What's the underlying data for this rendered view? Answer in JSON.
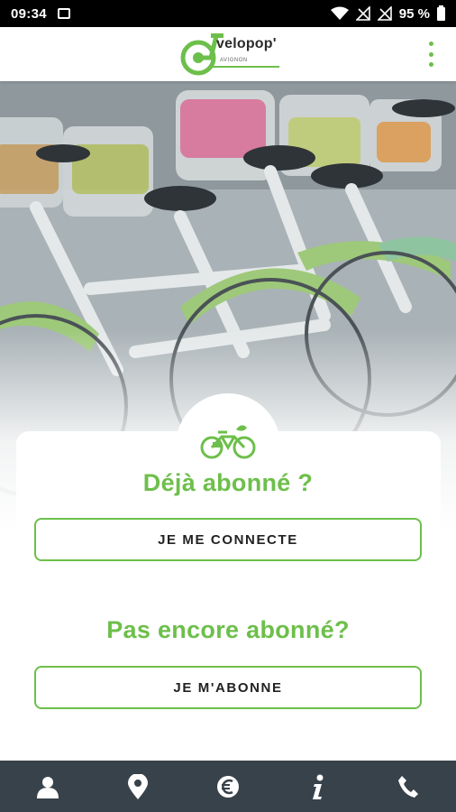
{
  "status_bar": {
    "time": "09:34",
    "battery_label": "95 %",
    "icons": [
      "image-icon",
      "wifi-icon",
      "no-signal-icon",
      "no-signal-icon",
      "battery-icon"
    ]
  },
  "header": {
    "logo_text": "velopop'",
    "logo_subtext": "AVIGNON",
    "menu_icon": "more-vert-icon"
  },
  "colors": {
    "accent": "#6dbf4b",
    "nav_background": "#38424a"
  },
  "subscribed": {
    "title": "Déjà abonné ?",
    "button_label": "JE ME CONNECTE"
  },
  "not_subscribed": {
    "title": "Pas encore abonné?",
    "button_label": "JE M'ABONNE"
  },
  "bottom_nav": {
    "items": [
      {
        "icon": "user-icon"
      },
      {
        "icon": "map-pin-icon"
      },
      {
        "icon": "euro-icon"
      },
      {
        "icon": "info-icon"
      },
      {
        "icon": "phone-icon"
      }
    ]
  }
}
